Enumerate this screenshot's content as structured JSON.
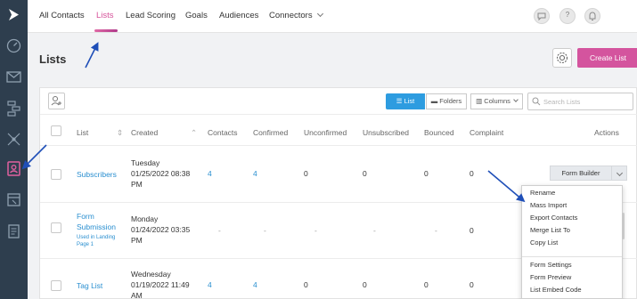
{
  "nav": {
    "items": [
      {
        "label": "All Contacts",
        "active": false
      },
      {
        "label": "Lists",
        "active": true
      },
      {
        "label": "Lead Scoring",
        "active": false
      },
      {
        "label": "Goals",
        "active": false
      },
      {
        "label": "Audiences",
        "active": false
      },
      {
        "label": "Connectors",
        "active": false
      }
    ],
    "help_label": "?"
  },
  "page": {
    "title": "Lists",
    "create_button": "Create List"
  },
  "toolbar": {
    "list_label": "List",
    "folders_label": "Folders",
    "columns_label": "Columns",
    "search_placeholder": "Search Lists"
  },
  "table": {
    "headers": [
      "List",
      "Created",
      "Contacts",
      "Confirmed",
      "Unconfirmed",
      "Unsubscribed",
      "Bounced",
      "Complaint",
      "Actions"
    ],
    "rows": [
      {
        "name": "Subscribers",
        "created": [
          "Tuesday",
          "01/25/2022 08:38",
          "PM"
        ],
        "contacts": "4",
        "confirmed": "4",
        "unconfirmed": "0",
        "unsubscribed": "0",
        "bounced": "0",
        "complaint": "0"
      },
      {
        "name": [
          "Form",
          "Submission"
        ],
        "note": [
          "Used in Landing",
          "Page 1"
        ],
        "created": [
          "Monday",
          "01/24/2022 03:35",
          "PM"
        ],
        "contacts": "-",
        "confirmed": "-",
        "unconfirmed": "-",
        "unsubscribed": "-",
        "bounced": "-",
        "complaint": "0"
      },
      {
        "name": "Tag List",
        "created": [
          "Wednesday",
          "01/19/2022 11:49",
          "AM"
        ],
        "contacts": "4",
        "confirmed": "4",
        "unconfirmed": "0",
        "unsubscribed": "0",
        "bounced": "0",
        "complaint": "0"
      }
    ]
  },
  "actions": {
    "form_builder": "Form Builder",
    "menu": [
      "Rename",
      "Mass Import",
      "Export Contacts",
      "Merge List To",
      "Copy List",
      "Form Settings",
      "Form Preview",
      "List Embed Code"
    ]
  },
  "colors": {
    "accent": "#d4549e",
    "primary": "#2d9ce0",
    "sidebar": "#2e3e4e",
    "annotation_arrow": "#1f4fb8"
  }
}
